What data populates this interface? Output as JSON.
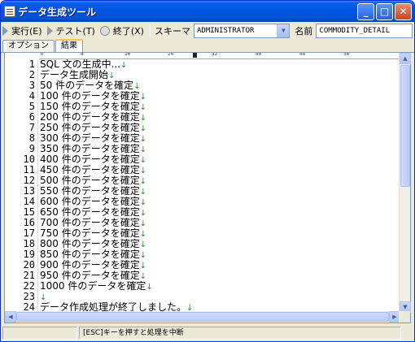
{
  "window": {
    "title": "データ生成ツール"
  },
  "title_buttons": {
    "minimize": "_",
    "maximize": "□",
    "close": "✕"
  },
  "toolbar": {
    "run_label": "実行(E)",
    "test_label": "テスト(T)",
    "end_label": "終了(X)",
    "schema_label": "スキーマ",
    "schema_value": "ADMINISTRATOR",
    "name_label": "名前",
    "name_value": "COMMODITY_DETAIL"
  },
  "tabs": [
    {
      "label": "オプション"
    },
    {
      "label": "結果"
    }
  ],
  "ruler": {
    "marks": [
      "0",
      "8",
      "16",
      "24",
      "32",
      "40",
      "48",
      "56"
    ]
  },
  "result": {
    "line_numbers": [
      "1",
      "2",
      "3",
      "4",
      "5",
      "6",
      "7",
      "8",
      "9",
      "10",
      "11",
      "12",
      "13",
      "14",
      "15",
      "16",
      "17",
      "18",
      "19",
      "20",
      "21",
      "22",
      "23",
      "24"
    ],
    "lines": [
      "SQL 文の生成中...",
      "データ生成開始",
      "50 件のデータを確定",
      "100 件のデータを確定",
      "150 件のデータを確定",
      "200 件のデータを確定",
      "250 件のデータを確定",
      "300 件のデータを確定",
      "350 件のデータを確定",
      "400 件のデータを確定",
      "450 件のデータを確定",
      "500 件のデータを確定",
      "550 件のデータを確定",
      "600 件のデータを確定",
      "650 件のデータを確定",
      "700 件のデータを確定",
      "750 件のデータを確定",
      "800 件のデータを確定",
      "850 件のデータを確定",
      "900 件のデータを確定",
      "950 件のデータを確定",
      "1000 件のデータを確定",
      "",
      "データ作成処理が終了しました。"
    ],
    "eol_marker": "↓"
  },
  "statusbar": {
    "message": "[ESC]キーを押すと処理を中断"
  },
  "colors": {
    "title_bar": "#0054e3",
    "eol_marker": "#2a8f2a",
    "tab_active": "#ffc83c"
  }
}
